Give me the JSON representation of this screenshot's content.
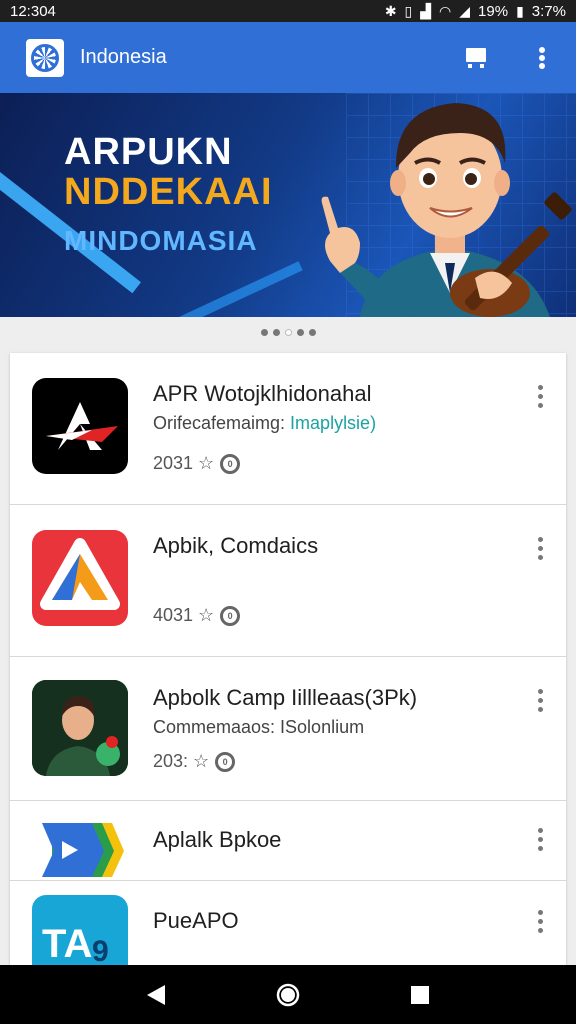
{
  "status": {
    "time": "12:304",
    "battery": "19%",
    "clock_right": "3:7%",
    "icons": [
      "bluetooth-icon",
      "vibrate-icon",
      "signal-icon",
      "wifi-icon",
      "cell-signal-icon",
      "battery-icon"
    ]
  },
  "appbar": {
    "title": "Indonesia",
    "icons": [
      "emblem-logo-icon",
      "cast-icon",
      "more-vert-icon"
    ],
    "color": "#2f6fd6"
  },
  "banner": {
    "line1": "ARPUKN",
    "line2": "NDDEKAAI",
    "line3": "MINDOMASIA"
  },
  "carousel": {
    "count": 5,
    "active_index": 2
  },
  "apps": [
    {
      "name": "APR Wotojklhidonahal",
      "sub_prefix": "Orifecafemaimg: ",
      "sub_highlight": "Imaplylsie)",
      "meta": "2031 ☆",
      "icon": "letter-a-arrow-icon"
    },
    {
      "name": "Apbik, Comdaics",
      "sub_prefix": "",
      "sub_highlight": "",
      "meta": "4031 ☆",
      "icon": "triangle-logo-icon"
    },
    {
      "name": "Apbolk Camp Iillleaas(3Pk)",
      "sub_prefix": "Commemaaos: ISolonlium",
      "sub_highlight": "",
      "meta": "203: ☆",
      "icon": "man-avatar-icon"
    },
    {
      "name": "Aplalk Bpkoe",
      "sub_prefix": "",
      "sub_highlight": "",
      "meta": "",
      "icon": "play-arrow-tag-icon"
    },
    {
      "name": "PueAPO",
      "sub_prefix": "",
      "sub_highlight": "",
      "meta": "",
      "icon": "tap-logo-icon"
    }
  ],
  "navbar": {
    "icons": [
      "back-icon",
      "home-icon",
      "recents-icon"
    ]
  }
}
